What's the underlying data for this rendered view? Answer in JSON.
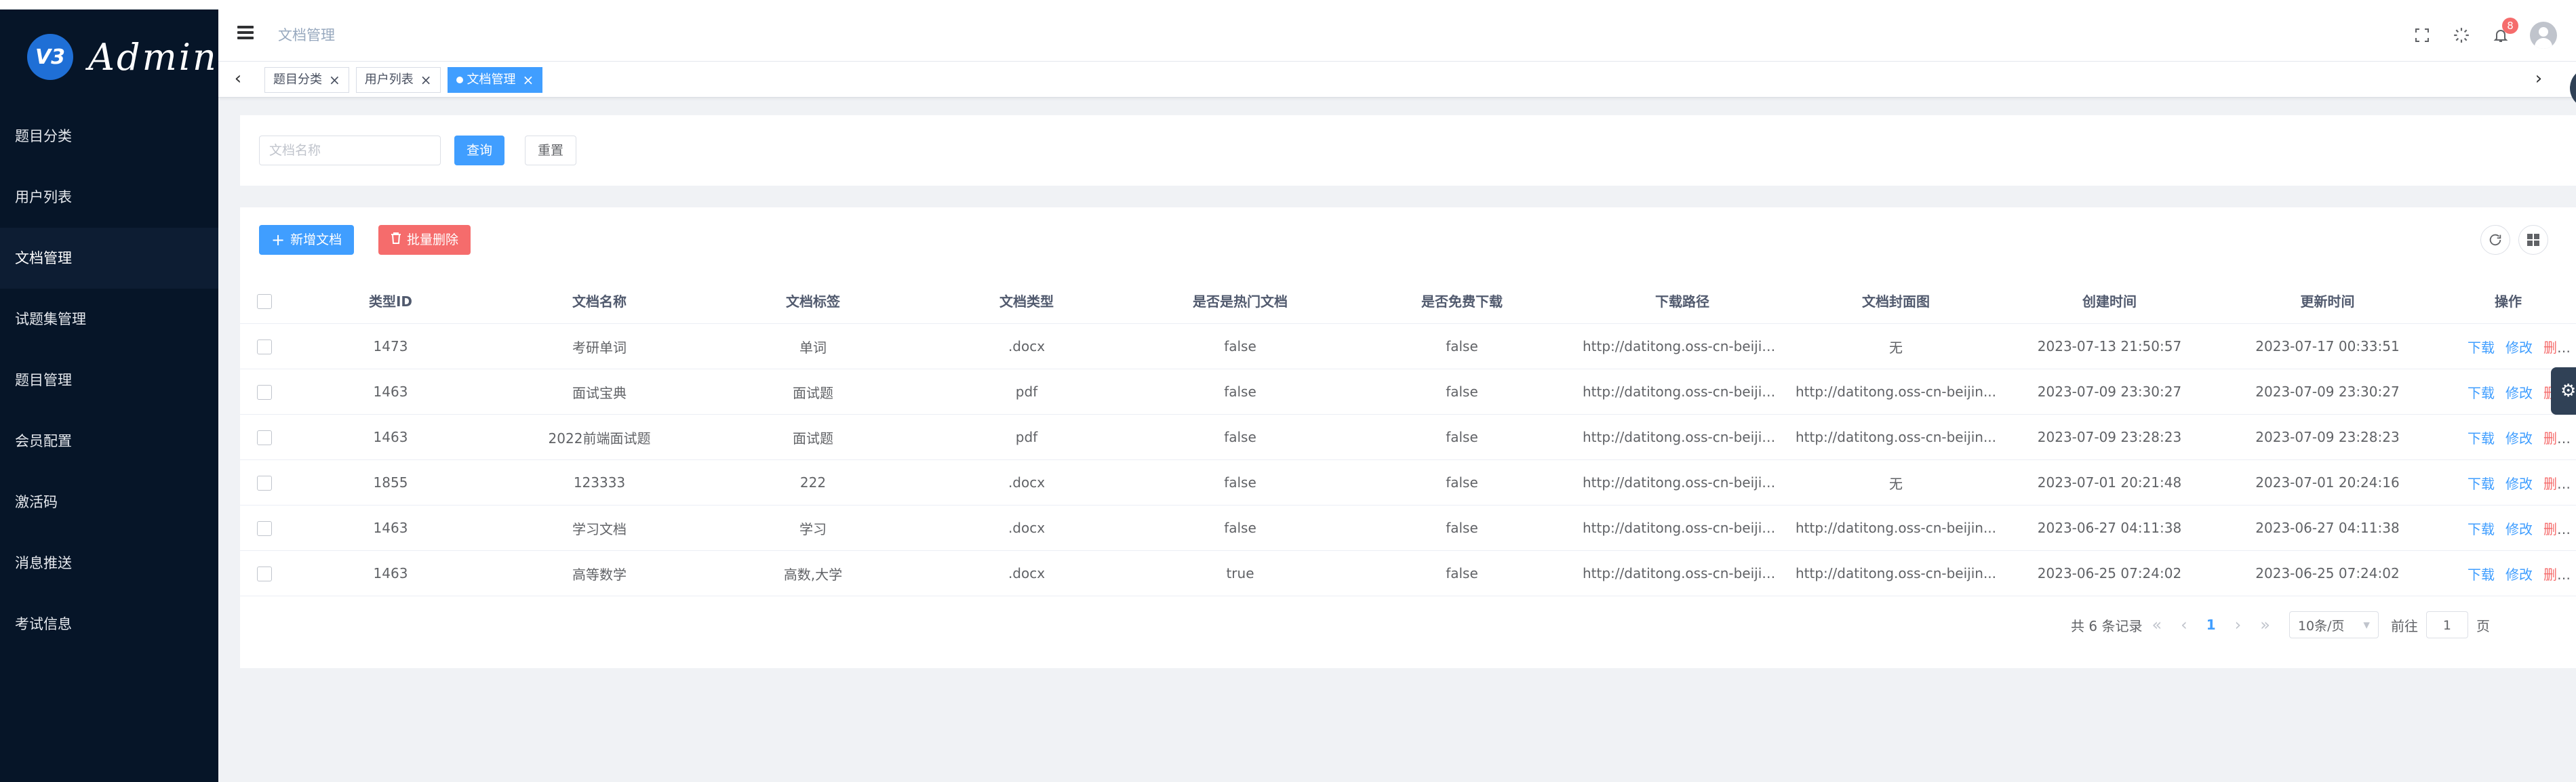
{
  "app": {
    "logo_mark": "V3",
    "logo_text": "Admin"
  },
  "sidebar": {
    "items": [
      {
        "label": "题目分类",
        "active": false
      },
      {
        "label": "用户列表",
        "active": false
      },
      {
        "label": "文档管理",
        "active": true
      },
      {
        "label": "试题集管理",
        "active": false
      },
      {
        "label": "题目管理",
        "active": false
      },
      {
        "label": "会员配置",
        "active": false
      },
      {
        "label": "激活码",
        "active": false
      },
      {
        "label": "消息推送",
        "active": false
      },
      {
        "label": "考试信息",
        "active": false
      }
    ]
  },
  "header": {
    "breadcrumb": "文档管理",
    "notification_count": "8",
    "icons": [
      "fullscreen-icon",
      "loading-icon",
      "bell-icon",
      "avatar"
    ]
  },
  "tags": [
    {
      "label": "题目分类",
      "active": false
    },
    {
      "label": "用户列表",
      "active": false
    },
    {
      "label": "文档管理",
      "active": true
    }
  ],
  "search": {
    "placeholder": "文档名称",
    "value": "",
    "query_label": "查询",
    "reset_label": "重置"
  },
  "toolbar": {
    "add_label": "新增文档",
    "batch_delete_label": "批量删除"
  },
  "table": {
    "columns": [
      "类型ID",
      "文档名称",
      "文档标签",
      "文档类型",
      "是否是热门文档",
      "是否免费下载",
      "下载路径",
      "文档封面图",
      "创建时间",
      "更新时间",
      "操作"
    ],
    "actions": {
      "download": "下载",
      "edit": "修改",
      "delete": "删除"
    },
    "rows": [
      [
        "1473",
        "考研单词",
        "单词",
        ".docx",
        "false",
        "false",
        "http://datitong.oss-cn-beijin...",
        "无",
        "2023-07-13 21:50:57",
        "2023-07-17 00:33:51"
      ],
      [
        "1463",
        "面试宝典",
        "面试题",
        "pdf",
        "false",
        "false",
        "http://datitong.oss-cn-beijin...",
        "http://datitong.oss-cn-beijin...",
        "2023-07-09 23:30:27",
        "2023-07-09 23:30:27"
      ],
      [
        "1463",
        "2022前端面试题",
        "面试题",
        "pdf",
        "false",
        "false",
        "http://datitong.oss-cn-beijin...",
        "http://datitong.oss-cn-beijin...",
        "2023-07-09 23:28:23",
        "2023-07-09 23:28:23"
      ],
      [
        "1855",
        "123333",
        "222",
        ".docx",
        "false",
        "false",
        "http://datitong.oss-cn-beijin...",
        "无",
        "2023-07-01 20:21:48",
        "2023-07-01 20:24:16"
      ],
      [
        "1463",
        "学习文档",
        "学习",
        ".docx",
        "false",
        "false",
        "http://datitong.oss-cn-beijin...",
        "http://datitong.oss-cn-beijin...",
        "2023-06-27 04:11:38",
        "2023-06-27 04:11:38"
      ],
      [
        "1463",
        "高等数学",
        "高数,大学",
        ".docx",
        "true",
        "false",
        "http://datitong.oss-cn-beijin...",
        "http://datitong.oss-cn-beijin...",
        "2023-06-25 07:24:02",
        "2023-06-25 07:24:02"
      ]
    ]
  },
  "pagination": {
    "total_text": "共 6 条记录",
    "current_page": "1",
    "page_size": "10条/页",
    "goto_label": "前往",
    "goto_value": "1",
    "page_suffix": "页"
  },
  "colors": {
    "primary": "#409eff",
    "danger": "#f56c6c",
    "sidebar_bg": "#061528"
  }
}
